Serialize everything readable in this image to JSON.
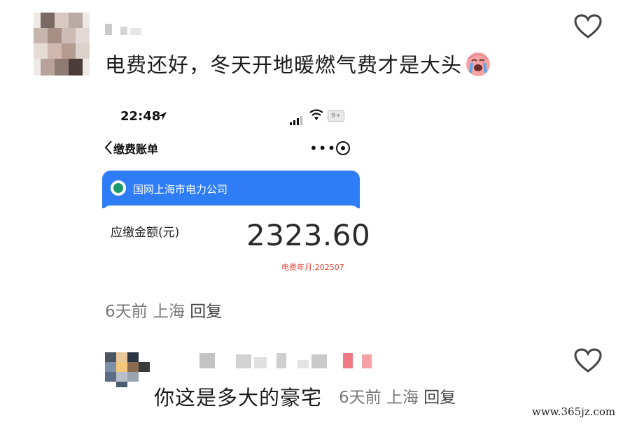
{
  "comment1": {
    "text": "电费还好，冬天开地暖燃气费才是大头",
    "emoji": "crying-face-emoji",
    "meta": {
      "time": "6天前",
      "location": "上海",
      "reply": "回复"
    }
  },
  "bill": {
    "status_time": "22:48",
    "battery": "9+",
    "nav_title": "缴费账单",
    "more": "•••",
    "company": "国网上海市电力公司",
    "amount_label": "应缴金额(元)",
    "amount": "2323.60",
    "period": "电费年月:202507"
  },
  "comment2": {
    "text": "你这是多大的豪宅",
    "meta": {
      "time": "6天前",
      "location": "上海",
      "reply": "回复"
    }
  },
  "watermark": "www.365jz.com",
  "colors": {
    "accent_blue": "#2f7df6",
    "period_red": "#e0463a"
  }
}
